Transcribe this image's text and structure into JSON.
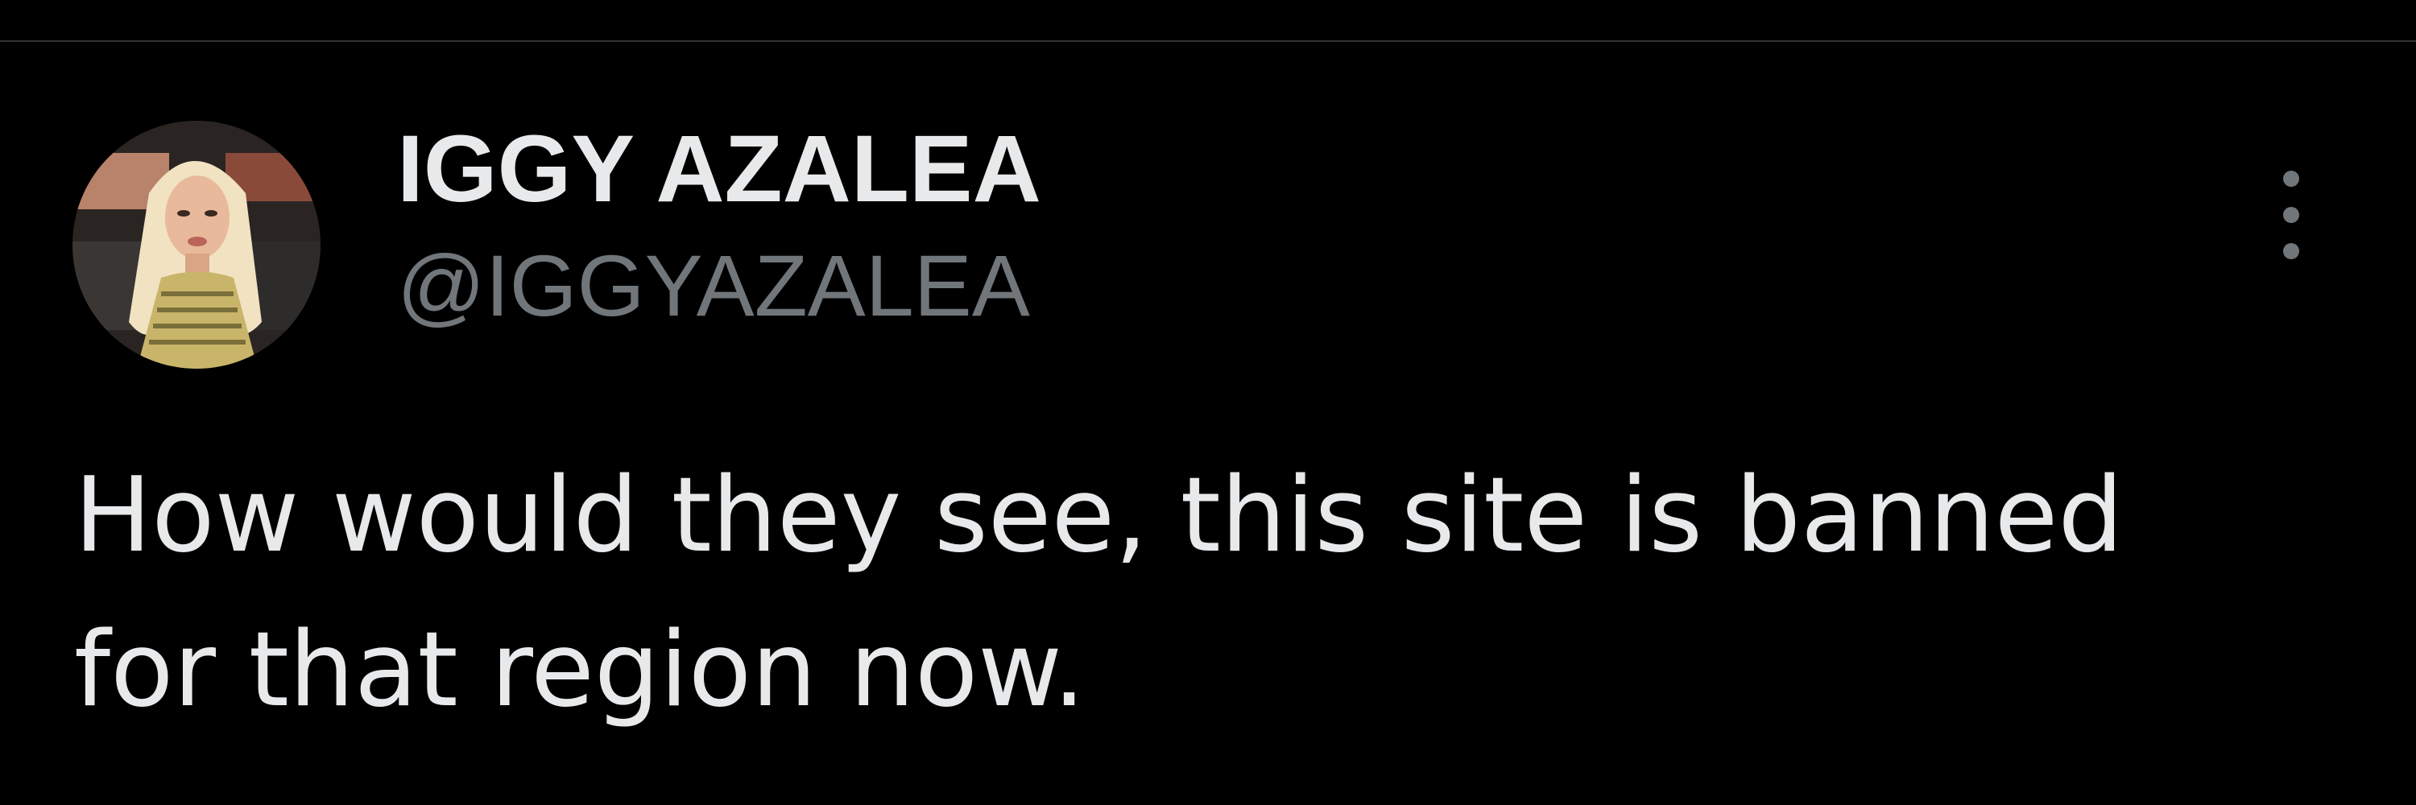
{
  "tweet": {
    "author": {
      "display_name": "IGGY AZALEA",
      "handle": "@IGGYAZALEA",
      "avatar_icon": "profile-photo"
    },
    "more_menu_icon": "more-vertical-icon",
    "text_line_1": "How would they see, this site is banned",
    "text_line_2": "for that region now."
  },
  "colors": {
    "background": "#000000",
    "primary_text": "#e7e9ea",
    "secondary_text": "#71767b",
    "divider": "#2f3336"
  }
}
